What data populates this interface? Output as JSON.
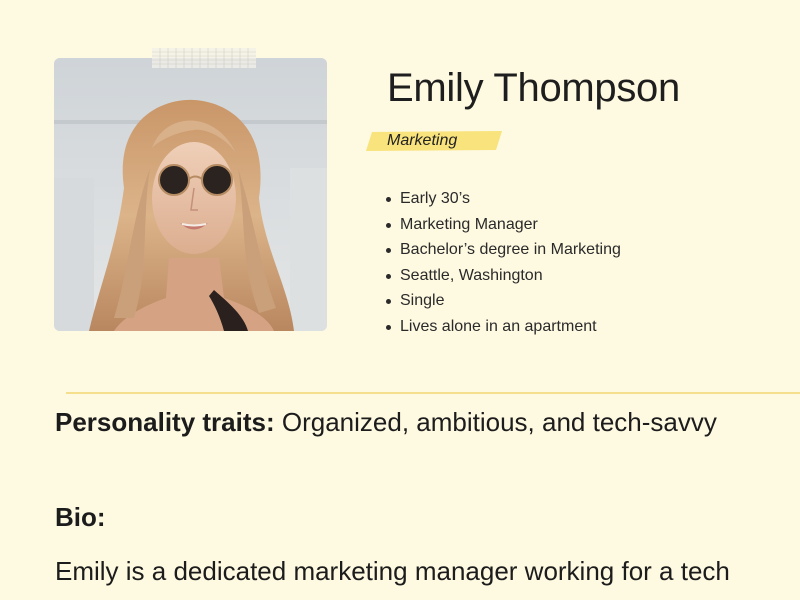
{
  "profile": {
    "name": "Emily Thompson",
    "department": "Marketing",
    "facts": [
      "Early 30’s",
      "Marketing Manager",
      "Bachelor’s degree in Marketing",
      "Seattle, Washington",
      "Single",
      "Lives alone in an apartment"
    ]
  },
  "traits": {
    "label": "Personality traits:",
    "value": "Organized, ambitious, and tech-savvy"
  },
  "bio": {
    "heading": "Bio:",
    "text": "Emily is a dedicated marketing manager working for a tech"
  },
  "colors": {
    "background": "#fef9e1",
    "highlight": "#f8e37c",
    "divider": "#f6df8c"
  }
}
